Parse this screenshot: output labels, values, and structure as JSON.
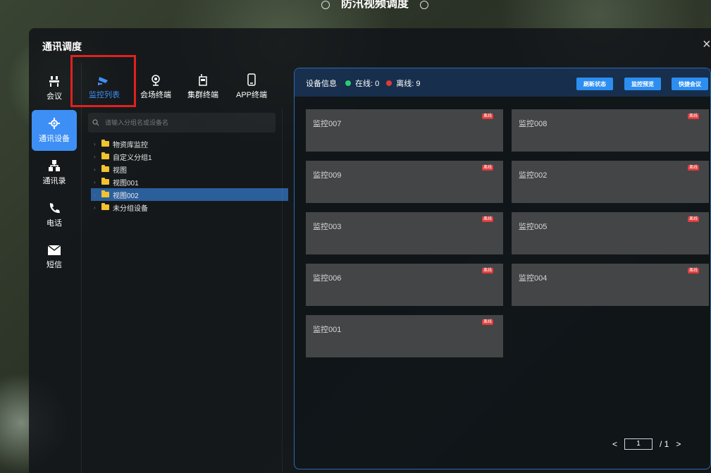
{
  "top_title": "防汛视频调度",
  "dialog": {
    "title": "通讯调度",
    "close": "×"
  },
  "rail": [
    {
      "label": "会议",
      "icon": "meeting-icon"
    },
    {
      "label": "通讯设备",
      "icon": "device-icon",
      "active": true
    },
    {
      "label": "通讯录",
      "icon": "contacts-icon"
    },
    {
      "label": "电话",
      "icon": "phone-icon"
    },
    {
      "label": "短信",
      "icon": "mail-icon"
    }
  ],
  "tabs": [
    {
      "label": "监控列表",
      "icon": "camera-icon",
      "active": true
    },
    {
      "label": "会场终端",
      "icon": "webcam-icon"
    },
    {
      "label": "集群终端",
      "icon": "radio-icon"
    },
    {
      "label": "APP终端",
      "icon": "mobile-icon"
    }
  ],
  "search": {
    "placeholder": "请输入分组名或设备名"
  },
  "tree": [
    {
      "label": "物资库监控"
    },
    {
      "label": "自定义分组1"
    },
    {
      "label": "视图"
    },
    {
      "label": "视图001"
    },
    {
      "label": "视图002",
      "selected": true
    },
    {
      "label": "未分组设备"
    }
  ],
  "panel": {
    "title": "设备信息",
    "online_label": "在线: 0",
    "offline_label": "离线: 9",
    "buttons": [
      "刷新状态",
      "监控预览",
      "快捷会议"
    ]
  },
  "cameras": [
    {
      "name": "监控007",
      "badge": "离线"
    },
    {
      "name": "监控008",
      "badge": "离线"
    },
    {
      "name": "监控009",
      "badge": "离线"
    },
    {
      "name": "监控002",
      "badge": "离线"
    },
    {
      "name": "监控003",
      "badge": "离线"
    },
    {
      "name": "监控005",
      "badge": "离线"
    },
    {
      "name": "监控006",
      "badge": "离线"
    },
    {
      "name": "监控004",
      "badge": "离线"
    },
    {
      "name": "监控001",
      "badge": "离线"
    }
  ],
  "pager": {
    "prev": "<",
    "current": "1",
    "total": "/ 1",
    "next": ">"
  },
  "colors": {
    "accent": "#3d8ff5",
    "online": "#2ecc71",
    "offline": "#e03a3a",
    "highlight": "#e02020"
  }
}
